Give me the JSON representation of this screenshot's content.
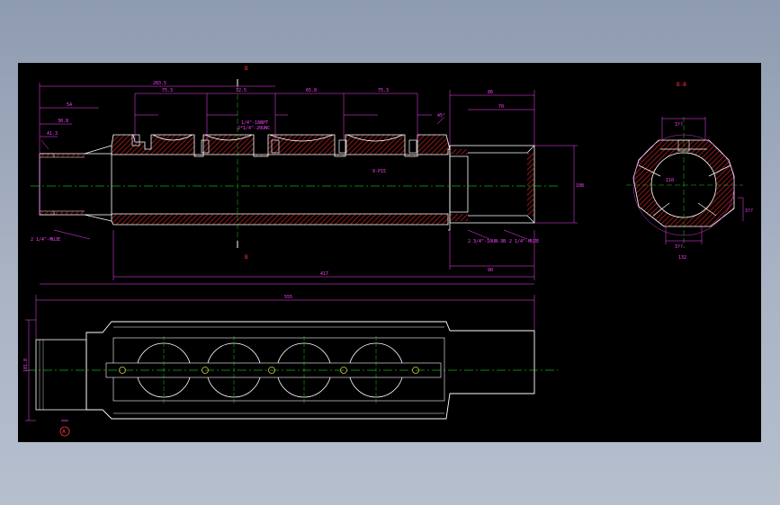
{
  "section_labels": {
    "cut_top": "B",
    "cut_bottom": "B",
    "section_view": "B-B",
    "datum": "A"
  },
  "annotations": {
    "main_pitch": "9-P15",
    "thread_left": "2 1/4\"-MUJE",
    "thread_right": "2 3/4\"-10UN-3B",
    "thread_right2": "2 1/4\"-MUJE",
    "hole_callout": "1/4\"-18NPT",
    "hole_callout2": "2*1/4\"-20UNC"
  },
  "dimensions": {
    "overall": "560",
    "top_span": "283.5",
    "pitch_1": "75.3",
    "pitch_2": "72.5",
    "pitch_3": "65.8",
    "pitch_4": "75.3",
    "right_len": "86",
    "right_inner": "70",
    "bottom_len": "417",
    "right_bottom": "90",
    "height_right": "108",
    "left_a": "54",
    "left_b": "30.8",
    "left_c": "41.3",
    "chamfer": "45°",
    "section_top": "3??",
    "section_bottom": "3??",
    "section_right": "3??",
    "section_dia": "110",
    "section_w": "132",
    "plan_len": "555",
    "plan_h": "101.8"
  },
  "colors": {
    "outline": "#ffffff",
    "dimension": "#ff44ff",
    "centerline": "#22ff22",
    "hatch": "#cc2222",
    "label": "#ff3333",
    "frame": "#000000"
  }
}
